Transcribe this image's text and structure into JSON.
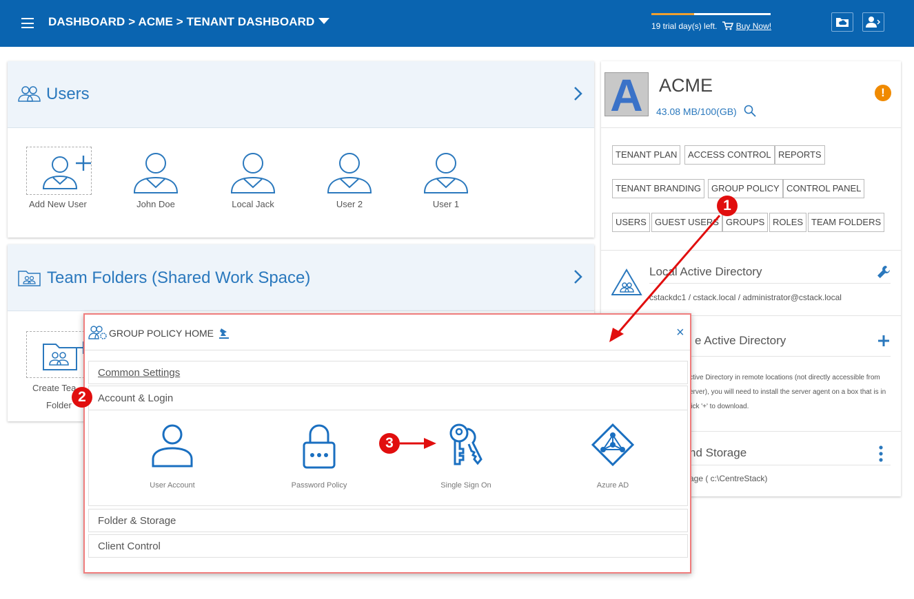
{
  "header": {
    "breadcrumb": "DASHBOARD > ACME > TENANT DASHBOARD",
    "trial_text": "19 trial day(s) left.",
    "buy_now": "Buy Now!",
    "trial_progress": 0.36,
    "icons": [
      "menu-icon",
      "cart-icon",
      "folder-cloud-icon",
      "user-account-icon"
    ]
  },
  "users_panel": {
    "title": "Users",
    "tiles": [
      {
        "label": "Add New User"
      },
      {
        "label": "John Doe"
      },
      {
        "label": "Local Jack"
      },
      {
        "label": "User 2"
      },
      {
        "label": "User 1"
      }
    ]
  },
  "team_folders_panel": {
    "title": "Team Folders (Shared Work Space)",
    "create_label_1": "Create Tea",
    "create_label_2": "Folder"
  },
  "tenant": {
    "avatar_letter": "A",
    "name": "ACME",
    "storage": "43.08 MB/100(GB)",
    "buttons": [
      "TENANT PLAN",
      "ACCESS CONTROL",
      "REPORTS",
      "TENANT BRANDING",
      "GROUP POLICY",
      "CONTROL PANEL",
      "USERS",
      "GUEST USERS",
      "GROUPS",
      "ROLES",
      "TEAM FOLDERS"
    ],
    "local_ad_title": "Local Active Directory",
    "local_ad_detail": "cstackdc1 / cstack.local / administrator@cstack.local",
    "remote_ad_title": "e Active Directory",
    "remote_ad_line1": "ctive Directory in remote locations (not directly accessible from",
    "remote_ad_line2": "erver), you will need to install the server agent on a box that is in",
    "remote_ad_line3": "lick '+' to download.",
    "storage_title": "nd Storage",
    "storage_detail": "age ( c:\\CentreStack)"
  },
  "group_policy": {
    "title": "GROUP POLICY HOME",
    "close": "×",
    "sections": [
      "Common Settings",
      "Account & Login",
      "Folder & Storage",
      "Client Control"
    ],
    "tiles": [
      {
        "label": "User Account"
      },
      {
        "label": "Password Policy"
      },
      {
        "label": "Single Sign On"
      },
      {
        "label": "Azure AD"
      }
    ]
  },
  "annotations": {
    "badge1": "1",
    "badge2": "2",
    "badge3": "3"
  },
  "colors": {
    "brand_blue": "#0a64b0",
    "accent_blue": "#2a78bd",
    "annotation_red": "#e10e0e",
    "warning_orange": "#f08a00"
  }
}
